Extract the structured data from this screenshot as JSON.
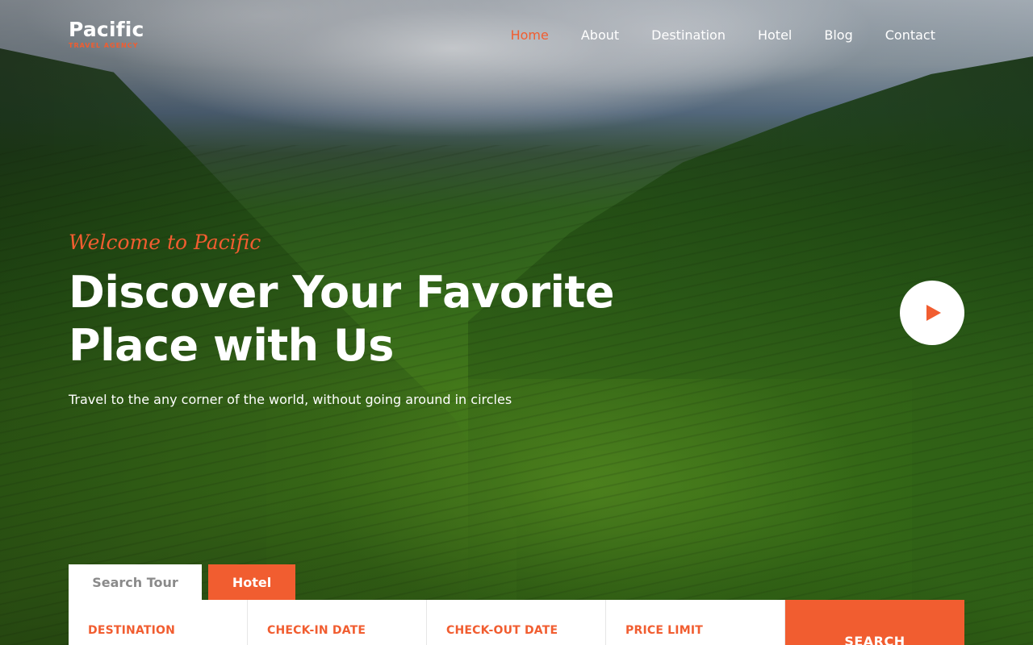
{
  "brand": {
    "name": "Pacific",
    "tagline": "TRAVEL AGENCY"
  },
  "nav": {
    "items": [
      {
        "label": "Home",
        "active": true
      },
      {
        "label": "About"
      },
      {
        "label": "Destination"
      },
      {
        "label": "Hotel"
      },
      {
        "label": "Blog"
      },
      {
        "label": "Contact"
      }
    ]
  },
  "hero": {
    "welcome": "Welcome to Pacific",
    "headline_line1": "Discover Your Favorite",
    "headline_line2": "Place with Us",
    "subtext": "Travel to the any corner of the world, without going around in circles",
    "play_icon": "play-icon"
  },
  "search": {
    "tabs": [
      {
        "label": "Search Tour"
      },
      {
        "label": "Hotel",
        "active": true
      }
    ],
    "fields": [
      {
        "label": "DESTINATION"
      },
      {
        "label": "CHECK-IN DATE"
      },
      {
        "label": "CHECK-OUT DATE"
      },
      {
        "label": "PRICE LIMIT"
      }
    ],
    "button_label": "SEARCH"
  },
  "colors": {
    "accent": "#f15d30",
    "text_light": "#ffffff",
    "tab_inactive_text": "#8a8a8a"
  }
}
